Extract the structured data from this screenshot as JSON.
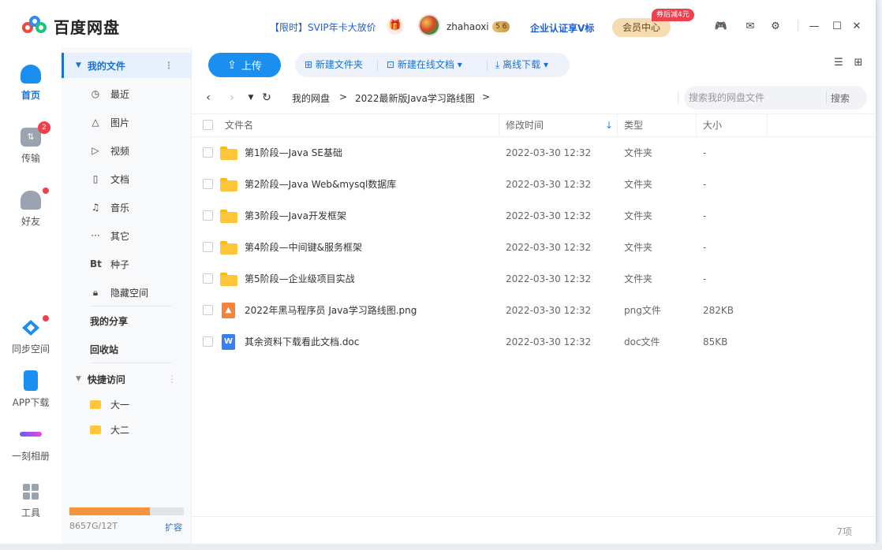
{
  "app": {
    "name": "百度网盘",
    "promo": "【限时】SVIP年卡大放价",
    "username": "zhahaoxi",
    "level_badge": "5 6",
    "enterprise": "企业认证享V标",
    "member_center": "会员中心",
    "member_tag": "券后减4元"
  },
  "rail": [
    {
      "label": "首页",
      "icon": "cloud-icon",
      "active": true
    },
    {
      "label": "传输",
      "icon": "transfer-icon",
      "badge": "2"
    },
    {
      "label": "好友",
      "icon": "friends-icon"
    },
    {
      "label": "同步空间",
      "icon": "sync-icon"
    },
    {
      "label": "APP下载",
      "icon": "phone-icon"
    },
    {
      "label": "一刻相册",
      "icon": "album-icon"
    },
    {
      "label": "工具",
      "icon": "tools-icon"
    }
  ],
  "sidebar": {
    "my_files": "我的文件",
    "items": [
      {
        "label": "最近",
        "icon": "clock-icon"
      },
      {
        "label": "图片",
        "icon": "image-icon"
      },
      {
        "label": "视频",
        "icon": "video-icon"
      },
      {
        "label": "文档",
        "icon": "document-icon"
      },
      {
        "label": "音乐",
        "icon": "music-icon"
      },
      {
        "label": "其它",
        "icon": "more-icon"
      },
      {
        "label": "种子",
        "icon": "torrent-icon",
        "glyph": "Bt"
      },
      {
        "label": "隐藏空间",
        "icon": "lock-icon"
      }
    ],
    "my_share": "我的分享",
    "recycle": "回收站",
    "quick_access": "快捷访问",
    "quick_items": [
      "大一",
      "大二"
    ],
    "storage_text": "8657G/12T",
    "storage_fraction": 0.7045,
    "expand": "扩容"
  },
  "toolbar": {
    "upload": "上传",
    "new_folder": "新建文件夹",
    "new_online_doc": "新建在线文档",
    "offline_download": "离线下载"
  },
  "breadcrumb": [
    "我的网盘",
    "2022最新版Java学习路线图"
  ],
  "search": {
    "placeholder": "搜索我的网盘文件",
    "button": "搜索"
  },
  "table": {
    "headers": {
      "name": "文件名",
      "modified": "修改时间",
      "type": "类型",
      "size": "大小"
    },
    "rows": [
      {
        "name": "第1阶段—Java SE基础",
        "modified": "2022-03-30 12:32",
        "type": "文件夹",
        "size": "-",
        "kind": "folder"
      },
      {
        "name": "第2阶段—Java Web&mysql数据库",
        "modified": "2022-03-30 12:32",
        "type": "文件夹",
        "size": "-",
        "kind": "folder"
      },
      {
        "name": "第3阶段—Java开发框架",
        "modified": "2022-03-30 12:32",
        "type": "文件夹",
        "size": "-",
        "kind": "folder"
      },
      {
        "name": "第4阶段—中间键&服务框架",
        "modified": "2022-03-30 12:32",
        "type": "文件夹",
        "size": "-",
        "kind": "folder"
      },
      {
        "name": "第5阶段—企业级项目实战",
        "modified": "2022-03-30 12:32",
        "type": "文件夹",
        "size": "-",
        "kind": "folder"
      },
      {
        "name": "2022年黑马程序员 Java学习路线图.png",
        "modified": "2022-03-30 12:32",
        "type": "png文件",
        "size": "282KB",
        "kind": "png"
      },
      {
        "name": "其余资料下载看此文档.doc",
        "modified": "2022-03-30 12:32",
        "type": "doc文件",
        "size": "85KB",
        "kind": "doc"
      }
    ]
  },
  "footer": {
    "count": "7项"
  },
  "colors": {
    "accent": "#1a8ff0",
    "folder": "#ffc63b",
    "badge": "#f0404b",
    "storage": "#f4953d"
  }
}
